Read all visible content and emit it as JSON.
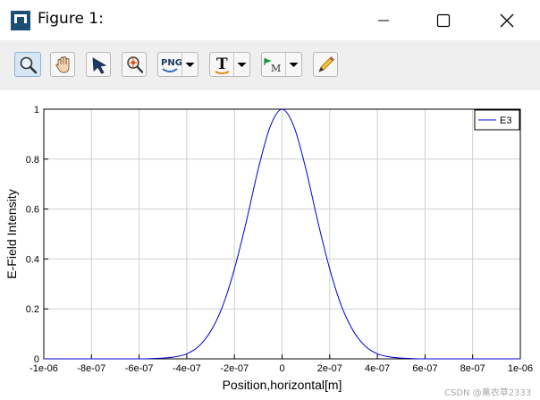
{
  "window": {
    "title": "Figure 1:"
  },
  "toolbar": {
    "buttons": [
      {
        "name": "zoom",
        "icon": "zoom-magnifier-icon",
        "active": true
      },
      {
        "name": "pan",
        "icon": "pan-hand-icon"
      },
      {
        "name": "select",
        "icon": "pointer-arrow-icon"
      },
      {
        "name": "zoom-reset",
        "icon": "zoom-target-icon"
      },
      {
        "name": "export-png",
        "icon": "png-export-icon",
        "label": "PNG",
        "dropdown": true
      },
      {
        "name": "text",
        "icon": "text-tool-icon",
        "label": "T",
        "dropdown": true
      },
      {
        "name": "marker",
        "icon": "marker-flag-icon",
        "label": "M",
        "dropdown": true
      },
      {
        "name": "edit",
        "icon": "pencil-icon"
      }
    ]
  },
  "colors": {
    "series": "#0000cc",
    "grid": "#d0d0d0",
    "axis": "#000000"
  },
  "chart_data": {
    "type": "line",
    "title": "",
    "xlabel": "Position,horizontal[m]",
    "ylabel": "E-Field Intensity",
    "xlim": [
      -1e-06,
      1e-06
    ],
    "ylim": [
      0,
      1
    ],
    "x_ticks": [
      -1e-06,
      -8e-07,
      -6e-07,
      -4e-07,
      -2e-07,
      0,
      2e-07,
      4e-07,
      6e-07,
      8e-07,
      1e-06
    ],
    "x_tick_labels": [
      "-1e-06",
      "-8e-07",
      "-6e-07",
      "-4e-07",
      "-2e-07",
      "0",
      "2e-07",
      "4e-07",
      "6e-07",
      "8e-07",
      "1e-06"
    ],
    "y_ticks": [
      0,
      0.2,
      0.4,
      0.6,
      0.8,
      1
    ],
    "y_tick_labels": [
      "0",
      "0.2",
      "0.4",
      "0.6",
      "0.8",
      "1"
    ],
    "grid": true,
    "legend_position": "top-right",
    "series": [
      {
        "name": "E3",
        "color": "#0000cc",
        "x": [
          -1e-06,
          -8e-07,
          -6e-07,
          -5.5e-07,
          -5e-07,
          -4.5e-07,
          -4e-07,
          -3.5e-07,
          -3e-07,
          -2.5e-07,
          -2e-07,
          -1.5e-07,
          -1e-07,
          -5e-08,
          0,
          5e-08,
          1e-07,
          1.5e-07,
          2e-07,
          2.5e-07,
          3e-07,
          3.5e-07,
          4e-07,
          4.5e-07,
          5e-07,
          5.5e-07,
          6e-07,
          8e-07,
          1e-06
        ],
        "y": [
          0,
          0,
          0,
          0.001,
          0.003,
          0.008,
          0.02,
          0.05,
          0.11,
          0.21,
          0.36,
          0.55,
          0.76,
          0.93,
          1.0,
          0.93,
          0.76,
          0.55,
          0.36,
          0.21,
          0.11,
          0.05,
          0.02,
          0.008,
          0.003,
          0.001,
          0,
          0,
          0
        ]
      }
    ]
  },
  "watermark": "CSDN @薰衣草2333"
}
